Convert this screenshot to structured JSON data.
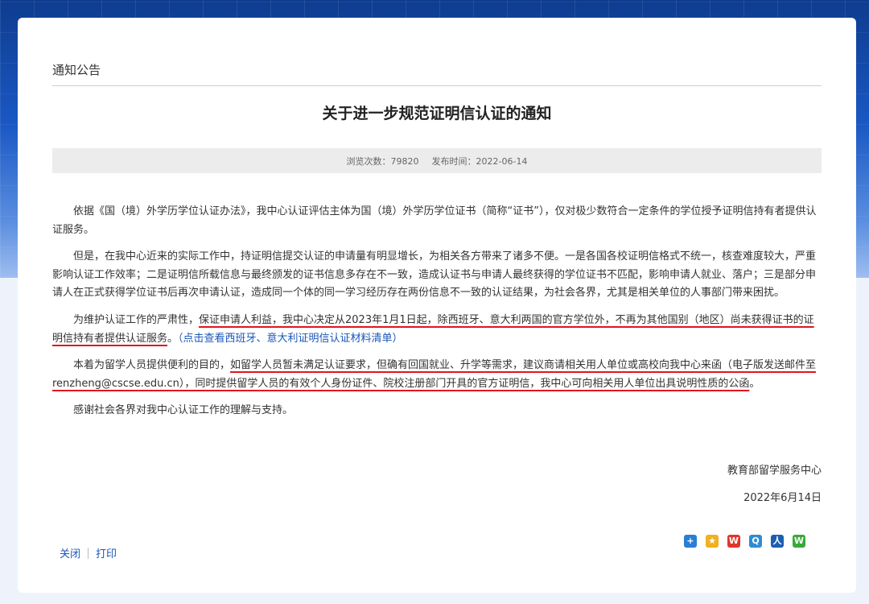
{
  "section": {
    "label": "通知公告"
  },
  "article": {
    "title": "关于进一步规范证明信认证的通知",
    "views_label": "浏览次数：",
    "views": "79820",
    "published_label": "发布时间：",
    "published": "2022-06-14"
  },
  "paragraphs": {
    "p1": "依据《国（境）外学历学位认证办法》，我中心认证评估主体为国（境）外学历学位证书（简称“证书”），仅对极少数符合一定条件的学位授予证明信持有者提供认证服务。",
    "p2": "但是，在我中心近来的实际工作中，持证明信提交认证的申请量有明显增长，为相关各方带来了诸多不便。一是各国各校证明信格式不统一，核查难度较大，严重影响认证工作效率；二是证明信所载信息与最终颁发的证书信息多存在不一致，造成认证书与申请人最终获得的学位证书不匹配，影响申请人就业、落户；三是部分申请人在正式获得学位证书后再次申请认证，造成同一个体的同一学习经历存在两份信息不一致的认证结果，为社会各界，尤其是相关单位的人事部门带来困扰。",
    "p3a": "为维护认证工作的严肃性，",
    "p3b": "保证申请人利益，我中心决定从2023年1月1日起，除西班牙、意大利两国的官方学位外，不再为其他国别（地区）尚未获得证书的证明信持有者提供认证服务",
    "p3c": "。",
    "p3link": "（点击查看西班牙、意大利证明信认证材料清单）",
    "p4a": "本着为留学人员提供便利的目的，",
    "p4b": "如留学人员暂未满足认证要求，但确有回国就业、升学等需求，建议商请相关用人单位或高校向我中心来函（电子版发送邮件至renzheng@cscse.edu.cn），同时提供留学人员的有效个人身份证件、院校注册部门开具的官方证明信，我中心可向相关用人单位出具说明性质的公函",
    "p4c": "。",
    "p5": "感谢社会各界对我中心认证工作的理解与支持。"
  },
  "signature": {
    "org": "教育部留学服务中心",
    "date": "2022年6月14日"
  },
  "footer": {
    "close": "关闭",
    "print": "打印"
  },
  "share": [
    {
      "icon": "share-plus-icon",
      "color": "#2a7fd4",
      "glyph": "+"
    },
    {
      "icon": "qzone-star-icon",
      "color": "#f2b01e",
      "glyph": "★"
    },
    {
      "icon": "weibo-icon",
      "color": "#e0362c",
      "glyph": "W"
    },
    {
      "icon": "tencent-weibo-icon",
      "color": "#2e8bd6",
      "glyph": "Q"
    },
    {
      "icon": "renren-icon",
      "color": "#1c5fb0",
      "glyph": "人"
    },
    {
      "icon": "wechat-icon",
      "color": "#3aa83a",
      "glyph": "W"
    }
  ]
}
